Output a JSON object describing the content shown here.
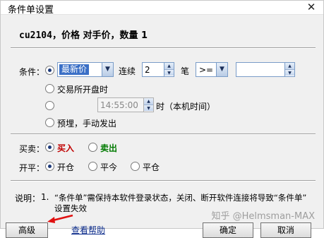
{
  "window": {
    "title": "条件单设置",
    "close_glyph": "✕"
  },
  "heading": {
    "contract": "cu2104，",
    "rest": "价格 对手价，数量 1"
  },
  "condition": {
    "label": "条件：",
    "option_price": {
      "price_type": "最新价",
      "continuous_label": "连续",
      "count": "2",
      "count_unit": "笔",
      "operator": ">=",
      "value": ""
    },
    "option_open": {
      "label": "交易所开盘时"
    },
    "option_time": {
      "time": "14:55:00",
      "suffix": "时（本机时间）"
    },
    "option_manual": {
      "label": "预埋，手动发出"
    }
  },
  "side": {
    "label": "买卖：",
    "buy": "买入",
    "sell": "卖出"
  },
  "offset": {
    "label": "开平：",
    "open": "开仓",
    "close_today": "平今",
    "close": "平仓"
  },
  "note": {
    "label": "说明：",
    "number": "1.",
    "line1": "“条件单”需保持本软件登录状态，关闭、断开软件连接将导致“条件单”",
    "line2": "设置失效"
  },
  "buttons": {
    "advanced": "高级",
    "help": "查看帮助",
    "ok": "确定",
    "cancel": "取消"
  },
  "watermark": "知乎 @Helmsman-MAX",
  "colors": {
    "buy": "#c00000",
    "sell": "#007a00",
    "accent": "#3a6fc6"
  }
}
